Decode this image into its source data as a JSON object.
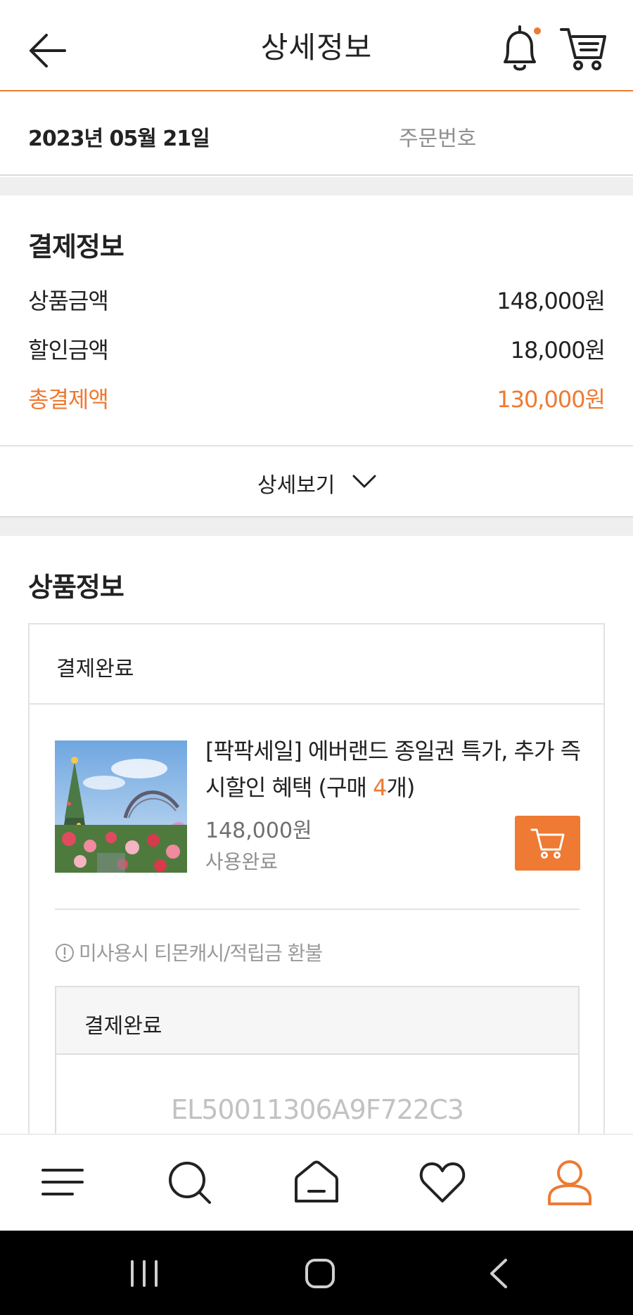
{
  "header": {
    "title": "상세정보"
  },
  "order": {
    "date": "2023년 05월 21일",
    "order_no_label": "주문번호"
  },
  "payment": {
    "title": "결제정보",
    "rows": [
      {
        "label": "상품금액",
        "value": "148,000원"
      },
      {
        "label": "할인금액",
        "value": "18,000원"
      },
      {
        "label": "총결제액",
        "value": "130,000원"
      }
    ],
    "detail_toggle": "상세보기"
  },
  "product": {
    "title": "상품정보",
    "status": "결제완료",
    "name": "[팍팍세일] 에버랜드 종일권 특가, 추가 즉시할인 혜택 (구매 ",
    "qty": "4",
    "name_suffix": "개)",
    "price": "148,000원",
    "use_status": "사용완료",
    "notice": "미사용시 티몬캐시/적립금 환불",
    "ticket": {
      "status": "결제완료",
      "code": "EL50011306A9F722C3"
    }
  },
  "colors": {
    "accent": "#ee7a33"
  },
  "icons": {
    "header": [
      "back-arrow-icon",
      "bell-icon",
      "cart-icon"
    ],
    "bottom_nav": [
      "menu-icon",
      "search-icon",
      "home-icon",
      "heart-icon",
      "user-icon"
    ],
    "system_nav": [
      "recent-apps-icon",
      "home-circle-icon",
      "back-chevron-icon"
    ]
  }
}
